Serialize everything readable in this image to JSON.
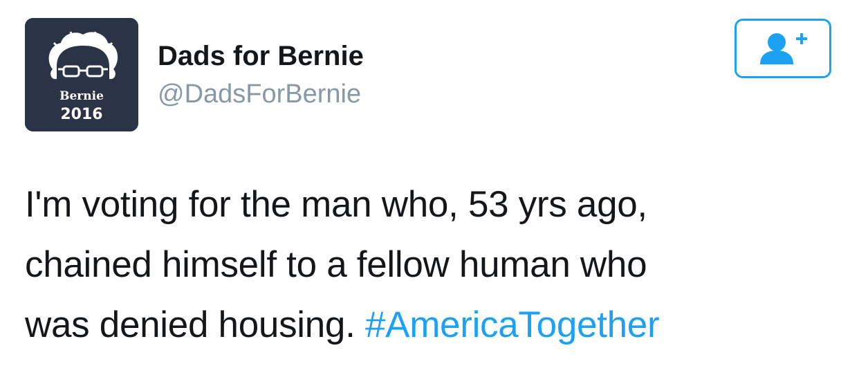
{
  "author": {
    "display_name": "Dads for Bernie",
    "handle": "@DadsForBernie",
    "avatar_text": [
      "Bernie",
      "2016"
    ]
  },
  "follow_button": {
    "icon": "add-user-icon",
    "color": "#1da1f2"
  },
  "tweet": {
    "lines": [
      "I'm voting for the man who, 53 yrs ago,",
      "chained himself to a fellow human who",
      "was denied housing."
    ],
    "hashtag": "#AmericaTogether"
  },
  "colors": {
    "text": "#14171a",
    "handle": "#8899a6",
    "accent": "#1da1f2",
    "avatar_bg": "#2b3346"
  }
}
